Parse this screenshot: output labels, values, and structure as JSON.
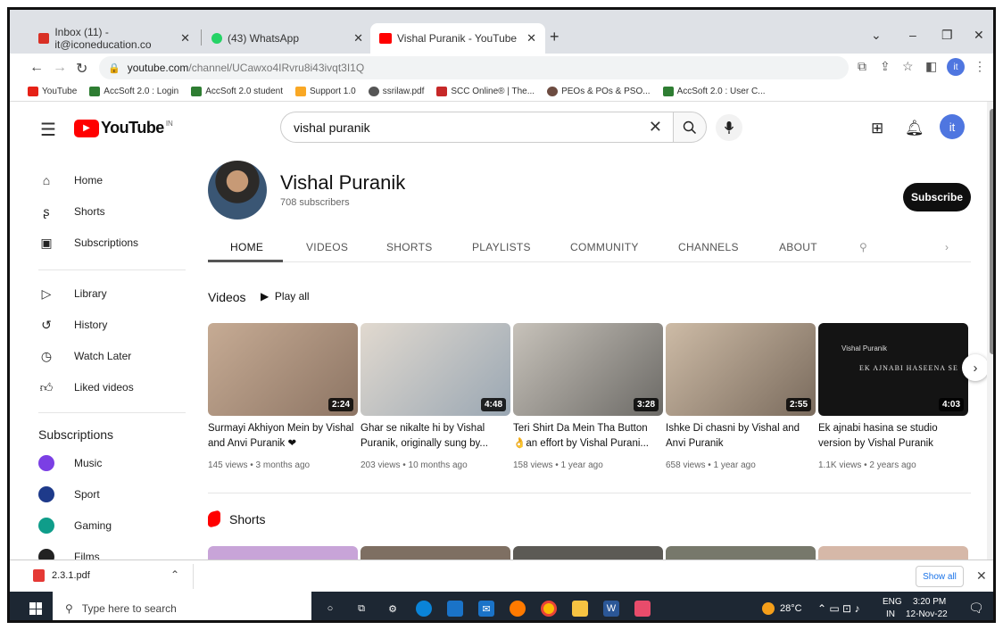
{
  "browser": {
    "tabs": [
      {
        "label": "Inbox (11) - it@iconeducation.co"
      },
      {
        "label": "(43) WhatsApp"
      },
      {
        "label": "Vishal Puranik - YouTube"
      }
    ],
    "new_tab": "+",
    "url_host": "youtube.com",
    "url_path": "/channel/UCawxo4IRvru8i43ivqt3I1Q",
    "bookmarks": [
      {
        "label": "YouTube",
        "color": "#e62117"
      },
      {
        "label": "AccSoft 2.0 : Login",
        "color": "#2e7d32"
      },
      {
        "label": "AccSoft 2.0 student",
        "color": "#2e7d32"
      },
      {
        "label": "Support 1.0",
        "color": "#f9a825"
      },
      {
        "label": "ssrilaw.pdf",
        "color": "#555555"
      },
      {
        "label": "SCC Online® | The...",
        "color": "#c62828"
      },
      {
        "label": "PEOs & POs & PSO...",
        "color": "#6d4c41"
      },
      {
        "label": "AccSoft 2.0 : User C...",
        "color": "#2e7d32"
      }
    ],
    "profile_initial": "it"
  },
  "youtube": {
    "logo_text": "YouTube",
    "country_code": "IN",
    "search_value": "vishal puranik",
    "avatar_initial": "it",
    "sidebar": {
      "items": [
        {
          "label": "Home",
          "icon": "home-icon"
        },
        {
          "label": "Shorts",
          "icon": "shorts-icon"
        },
        {
          "label": "Subscriptions",
          "icon": "subscriptions-icon"
        }
      ],
      "library_items": [
        {
          "label": "Library"
        },
        {
          "label": "History"
        },
        {
          "label": "Watch Later"
        },
        {
          "label": "Liked videos"
        }
      ],
      "subscriptions_heading": "Subscriptions",
      "subscriptions": [
        {
          "label": "Music",
          "color": "#7b3fe4"
        },
        {
          "label": "Sport",
          "color": "#1e3a8a"
        },
        {
          "label": "Gaming",
          "color": "#0f9d8a"
        },
        {
          "label": "Films",
          "color": "#222222"
        }
      ]
    },
    "channel": {
      "name": "Vishal Puranik",
      "subscribers": "708 subscribers",
      "subscribe_label": "Subscribe",
      "tabs": [
        "HOME",
        "VIDEOS",
        "SHORTS",
        "PLAYLISTS",
        "COMMUNITY",
        "CHANNELS",
        "ABOUT"
      ],
      "videos_heading": "Videos",
      "play_all": "Play all",
      "shorts_heading": "Shorts",
      "videos": [
        {
          "title": "Surmayi Akhiyon Mein by Vishal and Anvi Puranik ❤",
          "meta": "145 views • 3 months ago",
          "duration": "2:24",
          "bg": "#b89a82"
        },
        {
          "title": "Ghar se nikalte hi by Vishal Puranik, originally sung by...",
          "meta": "203 views • 10 months ago",
          "duration": "4:48",
          "bg": "#c9c3b8"
        },
        {
          "title": "Teri Shirt Da Mein Tha Button 👌an effort by Vishal Purani...",
          "meta": "158 views • 1 year ago",
          "duration": "3:28",
          "bg": "#a9a49c"
        },
        {
          "title": "Ishke Di chasni by Vishal and Anvi Puranik",
          "meta": "658 views • 1 year ago",
          "duration": "2:55",
          "bg": "#b9aa99"
        },
        {
          "title": "Ek ajnabi hasina se studio version by Vishal Puranik",
          "meta": "1.1K views • 2 years ago",
          "duration": "4:03",
          "bg": "#1a1a1a",
          "overlay_title": "Vishal Puranik",
          "overlay_sub": "Ek Ajnabi Haseena Se"
        }
      ]
    }
  },
  "downloads": {
    "file": "2.3.1.pdf",
    "show_all": "Show all"
  },
  "taskbar": {
    "search_placeholder": "Type here to search",
    "temperature": "28°C",
    "lang": "ENG",
    "region": "IN",
    "time": "3:20 PM",
    "date": "12-Nov-22"
  }
}
